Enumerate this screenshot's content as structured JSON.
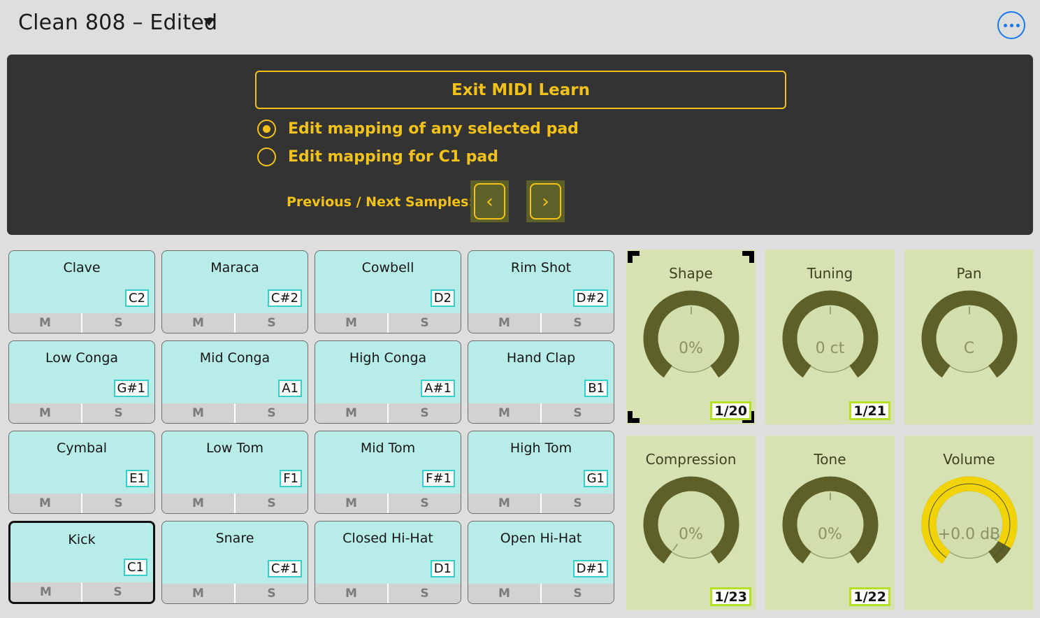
{
  "header": {
    "preset_title": "Clean 808 – Edited",
    "caret_icon": "chevron-down-icon",
    "more_icon": "ellipsis-icon",
    "accent_blue": "#1878f0"
  },
  "midi_learn": {
    "exit_button_label": "Exit MIDI Learn",
    "accent_yellow": "#f2c21b",
    "panel_bg": "#333333",
    "options": [
      {
        "label": "Edit mapping of any selected pad",
        "selected": true
      },
      {
        "label": "Edit mapping for C1 pad",
        "selected": false
      }
    ],
    "prev_next_label": "Previous / Next Samples:",
    "prev_icon": "chevron-left-icon",
    "next_icon": "chevron-right-icon",
    "prev_glyph": "‹",
    "next_glyph": "›"
  },
  "pads": {
    "mute_label": "M",
    "solo_label": "S",
    "pad_color": "#b8ece8",
    "note_border_color": "#35cfc9",
    "items": [
      {
        "name": "Clave",
        "note": "C2",
        "selected": false
      },
      {
        "name": "Maraca",
        "note": "C#2",
        "selected": false
      },
      {
        "name": "Cowbell",
        "note": "D2",
        "selected": false
      },
      {
        "name": "Rim Shot",
        "note": "D#2",
        "selected": false
      },
      {
        "name": "Low Conga",
        "note": "G#1",
        "selected": false
      },
      {
        "name": "Mid Conga",
        "note": "A1",
        "selected": false
      },
      {
        "name": "High Conga",
        "note": "A#1",
        "selected": false
      },
      {
        "name": "Hand Clap",
        "note": "B1",
        "selected": false
      },
      {
        "name": "Cymbal",
        "note": "E1",
        "selected": false
      },
      {
        "name": "Low Tom",
        "note": "F1",
        "selected": false
      },
      {
        "name": "Mid Tom",
        "note": "F#1",
        "selected": false
      },
      {
        "name": "High Tom",
        "note": "G1",
        "selected": false
      },
      {
        "name": "Kick",
        "note": "C1",
        "selected": true
      },
      {
        "name": "Snare",
        "note": "C#1",
        "selected": false
      },
      {
        "name": "Closed Hi-Hat",
        "note": "D1",
        "selected": false
      },
      {
        "name": "Open Hi-Hat",
        "note": "D#1",
        "selected": false
      }
    ]
  },
  "knobs": {
    "panel_bg": "#d7e2b3",
    "ring_color": "#5d6129",
    "highlight_color": "#f2d307",
    "badge_border": "#b5e02a",
    "items": [
      {
        "name": "Shape",
        "value": "0%",
        "cc": "1/20",
        "pointer_deg": 0,
        "fill_deg": 0,
        "highlighted": false,
        "learn_selected": true
      },
      {
        "name": "Tuning",
        "value": "0 ct",
        "cc": "1/21",
        "pointer_deg": 0,
        "fill_deg": 0,
        "highlighted": false,
        "learn_selected": false
      },
      {
        "name": "Pan",
        "value": "C",
        "cc": "",
        "pointer_deg": 0,
        "fill_deg": 0,
        "highlighted": false,
        "learn_selected": false
      },
      {
        "name": "Compression",
        "value": "0%",
        "cc": "1/23",
        "pointer_deg": -145,
        "fill_deg": 0,
        "highlighted": false,
        "learn_selected": false
      },
      {
        "name": "Tone",
        "value": "0%",
        "cc": "1/22",
        "pointer_deg": 0,
        "fill_deg": 0,
        "highlighted": false,
        "learn_selected": false
      },
      {
        "name": "Volume",
        "value": "+0.0 dB",
        "cc": "",
        "pointer_deg": 120,
        "fill_deg": 265,
        "highlighted": true,
        "learn_selected": false
      }
    ]
  }
}
